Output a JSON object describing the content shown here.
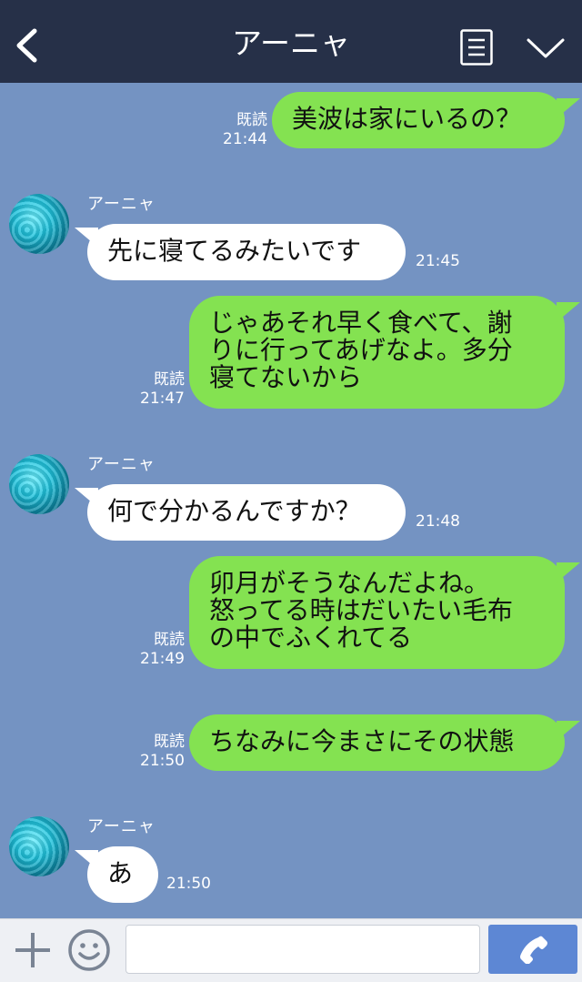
{
  "header": {
    "title": "アーニャ",
    "back_icon": "chevron-left-icon",
    "menu_icon": "menu-list-icon",
    "collapse_icon": "chevron-down-icon"
  },
  "messages": [
    {
      "side": "right",
      "text": "美波は家にいるの？",
      "read": "既読",
      "time": "21:44"
    },
    {
      "side": "left",
      "sender": "アーニャ",
      "text": "先に寝てるみたいです",
      "time": "21:45"
    },
    {
      "side": "right",
      "text": "じゃあそれ早く食べて、謝\nりに行ってあげなよ。多分\n寝てないから",
      "read": "既読",
      "time": "21:47"
    },
    {
      "side": "left",
      "sender": "アーニャ",
      "text": "何で分かるんですか？",
      "time": "21:48"
    },
    {
      "side": "right",
      "text": "卯月がそうなんだよね。\n怒ってる時はだいたい毛布\nの中でふくれてる",
      "read": "既読",
      "time": "21:49"
    },
    {
      "side": "right",
      "text": "ちなみに今まさにその状態",
      "read": "既読",
      "time": "21:50"
    },
    {
      "side": "left",
      "sender": "アーニャ",
      "text": "あ",
      "time": "21:50"
    }
  ],
  "composer": {
    "placeholder": "",
    "add_icon": "plus-icon",
    "emoji_icon": "smiley-icon",
    "call_icon": "phone-icon"
  },
  "colors": {
    "background": "#7493c2",
    "header": "#263048",
    "sent_bubble": "#84e251",
    "received_bubble": "#ffffff",
    "call_button": "#5d87d4"
  }
}
